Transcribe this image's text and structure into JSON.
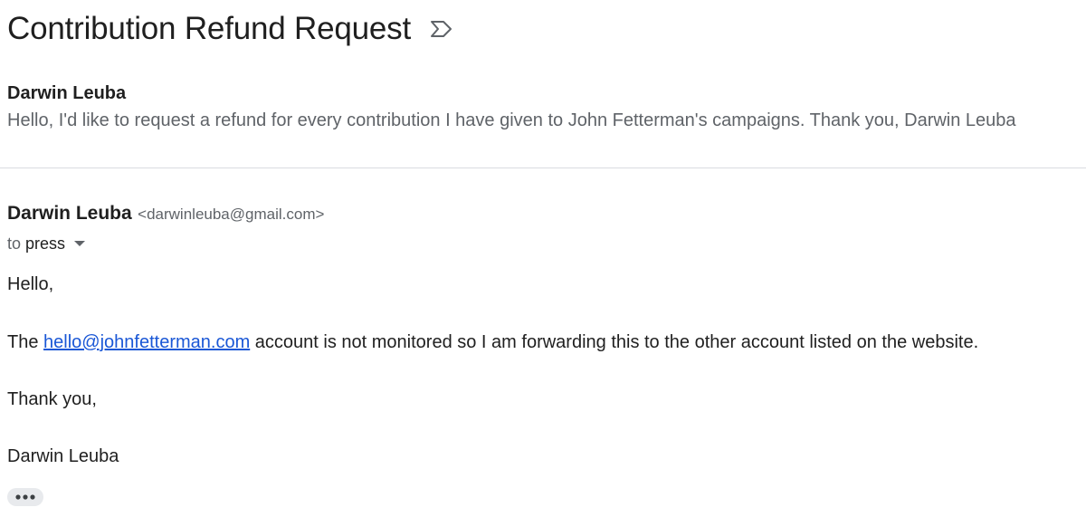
{
  "thread": {
    "subject": "Contribution Refund Request"
  },
  "collapsed_message": {
    "sender_name": "Darwin Leuba",
    "snippet": "Hello, I'd like to request a refund for every contribution I have given to John Fetterman's campaigns. Thank you, Darwin Leuba"
  },
  "open_message": {
    "sender_name": "Darwin Leuba",
    "sender_email": "<darwinleuba@gmail.com>",
    "to_prefix": "to",
    "to_recipient": "press",
    "body": {
      "greeting": "Hello,",
      "line_prefix": "The",
      "link_text": "hello@johnfetterman.com",
      "line_suffix": "account is not monitored so I am forwarding this to the other account listed on the website.",
      "closing": "Thank you,",
      "signature": "Darwin Leuba"
    }
  },
  "icons": {
    "label": "label-outline-icon",
    "more": "more-horiz-icon"
  },
  "colors": {
    "link": "#1a57d6",
    "divider": "#dadce0",
    "muted_text": "#5f6368"
  }
}
